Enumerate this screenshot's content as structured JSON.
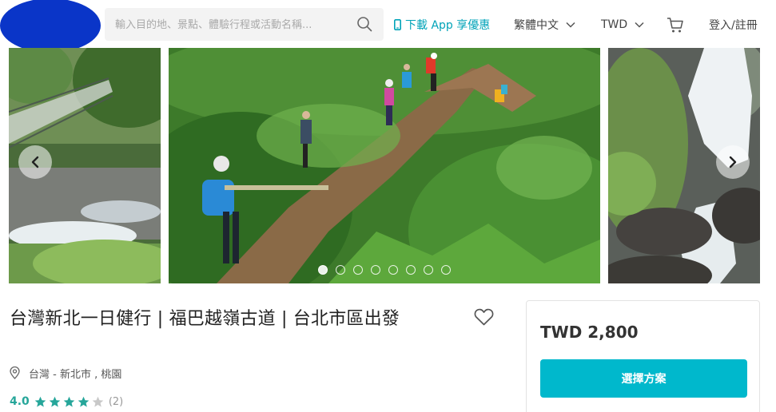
{
  "header": {
    "search_placeholder": "輸入目的地、景點、體驗行程或活動名稱...",
    "app_download_label": "下載 App 享優惠",
    "language_label": "繁體中文",
    "currency_label": "TWD",
    "login_label": "登入/註冊",
    "logo_color": "#0a35c8"
  },
  "gallery": {
    "slide_count": 8,
    "active_index": 0
  },
  "product": {
    "title": "台灣新北一日健行 | 福巴越嶺古道 | 台北市區出發",
    "location": "台灣 - 新北市 , 桃園",
    "rating_value": "4.0",
    "rating_stars": 4,
    "rating_max": 5,
    "review_count": "(2)"
  },
  "booking": {
    "price": "TWD 2,800",
    "select_plan_label": "選擇方案"
  },
  "colors": {
    "accent": "#00a3b8",
    "button": "#00b8cc",
    "rating": "#26a69a"
  }
}
